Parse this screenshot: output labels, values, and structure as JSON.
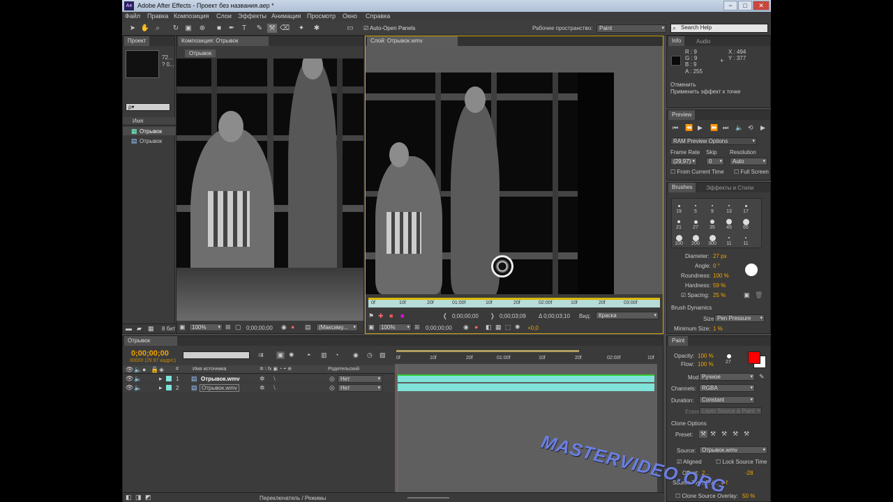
{
  "title": "Adobe After Effects - Проект без названия.aep *",
  "window_buttons": [
    "−",
    "□",
    "✕"
  ],
  "menu": [
    "Файл",
    "Правка",
    "Композиция",
    "Слои",
    "Эффекты",
    "Анимация",
    "Просмотр",
    "Окно",
    "Справка"
  ],
  "toolbar": {
    "auto_open": "Auto-Open Panels",
    "workspace_label": "Рабочее пространство:",
    "workspace_value": "Paint",
    "search_placeholder": "Search Help"
  },
  "project": {
    "tab": "Проект",
    "thumb_info1": "72...",
    "thumb_info2": "? 0...",
    "search": "ρ▾",
    "col_name": "Имя",
    "items": [
      "Отрывок",
      "Отрывок"
    ],
    "bpc": "8 бит"
  },
  "comp": {
    "tab": "Композиция: Отрывок",
    "breadcrumb": "Отрывок",
    "zoom": "100%",
    "time": "0;00;00;00",
    "res": "(Максиму..."
  },
  "layer": {
    "tab": "Слой: Отрывок.wmv",
    "ticks": [
      "0f",
      "10f",
      "20f",
      "01:00f",
      "10f",
      "20f",
      "02:00f",
      "10f",
      "20f",
      "03:00f"
    ],
    "zoom": "100%",
    "time": "0;00;00;00",
    "t_in": "0;00;00;00",
    "t_out": "0;00;03;09",
    "t_dur": "Δ 0;00;03;10",
    "view_label": "Вид:",
    "view_value": "Краска",
    "exposure": "+0,0"
  },
  "info": {
    "tab": "Info",
    "tab2": "Audio",
    "r": "R : 9",
    "g": "G : 9",
    "b": "B : 9",
    "a": "A : 255",
    "x": "X : 494",
    "y": "Y : 377",
    "undo": "Отменить",
    "action": "Применить эффект к точке"
  },
  "preview": {
    "tab": "Preview",
    "ram": "RAM Preview Options",
    "frame_rate": "Frame Rate",
    "skip": "Skip",
    "resolution": "Resolution",
    "fr_val": "(29,97)",
    "skip_val": "0",
    "res_val": "Auto",
    "from_current": "From Current Time",
    "full_screen": "Full Screen"
  },
  "brushes": {
    "tab": "Brushes",
    "tab2": "Эффекты и Стили",
    "sizes": [
      "19",
      "5",
      "9",
      "13",
      "17",
      "21",
      "27",
      "35",
      "45",
      "65",
      "100",
      "200",
      "300",
      "11",
      "11"
    ],
    "diameter_label": "Diameter:",
    "diameter": "27 px",
    "angle_label": "Angle:",
    "angle": "0 °",
    "roundness_label": "Roundness:",
    "roundness": "100 %",
    "hardness_label": "Hardness:",
    "hardness": "59 %",
    "spacing_label": "Spacing:",
    "spacing": "25 %",
    "dynamics": "Brush Dynamics",
    "size_label": "Size:",
    "size_value": "Pen Pressure",
    "min_label": "Minimum Size:",
    "min_value": "1 %"
  },
  "timeline": {
    "tab": "Отрывок",
    "time": "0;00;00;00",
    "fps": "00000 (29.97 кадр/с)",
    "col_source": "Имя источника",
    "col_parent": "Родительский",
    "layers": [
      {
        "num": "1",
        "name": "Отрывок.wmv",
        "parent": "Нет"
      },
      {
        "num": "2",
        "name": "Отрывок.wmv",
        "parent": "Нет"
      }
    ],
    "ticks": [
      "0f",
      "10f",
      "20f",
      "01:00f",
      "10f",
      "20f",
      "02:00f",
      "10f"
    ],
    "switch": "Переключатель / Режимы"
  },
  "paint": {
    "tab": "Paint",
    "opacity_label": "Opacity:",
    "opacity": "100 %",
    "flow_label": "Flow:",
    "flow": "100 %",
    "brush_size": "27",
    "mode_label": "Mode:",
    "mode": "Ручное",
    "channels_label": "Channels:",
    "channels": "RGBA",
    "duration_label": "Duration:",
    "duration": "Constant",
    "erase_label": "Erase:",
    "erase": "Layer Source & Paint",
    "clone_options": "Clone Options",
    "preset_label": "Preset:",
    "source_label": "Source:",
    "source": "Отрывок.wmv",
    "aligned": "Aligned",
    "lock_source": "Lock Source Time",
    "offset_label": "Offset:",
    "offset_x": "2...",
    "offset_y": "-28",
    "shift_label": "Source Time Shift:",
    "shift": "0 f",
    "overlay_label": "Clone Source Overlay:",
    "overlay": "50 %"
  },
  "watermark": "MASTERVIDEO.ORG",
  "colors": {
    "accent": "#f2a400",
    "track": "#7fe3d9",
    "foreground": "#ff0000"
  }
}
